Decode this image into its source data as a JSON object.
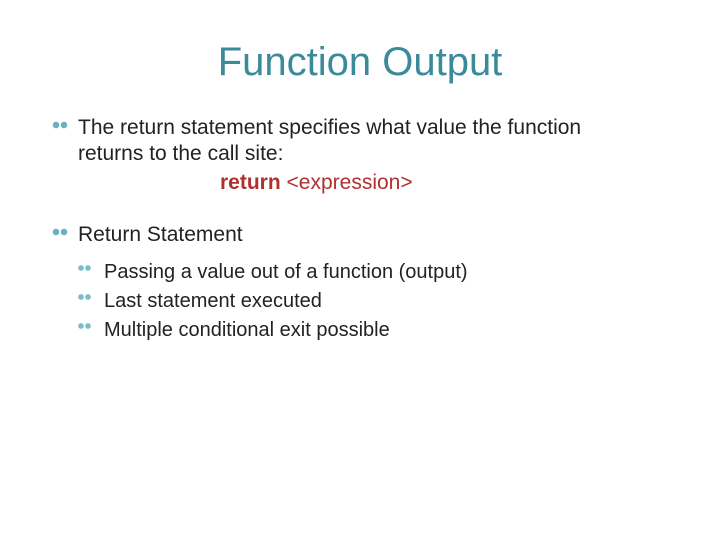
{
  "title": "Function Output",
  "point1_a": "The return statement specifies what value the function",
  "point1_b": "returns to the call site:",
  "code_kw": "return",
  "code_expr": "<expression>",
  "point2": "Return Statement",
  "sub1": "Passing a value out of a function (output)",
  "sub2": "Last statement executed",
  "sub3": "Multiple conditional exit possible"
}
